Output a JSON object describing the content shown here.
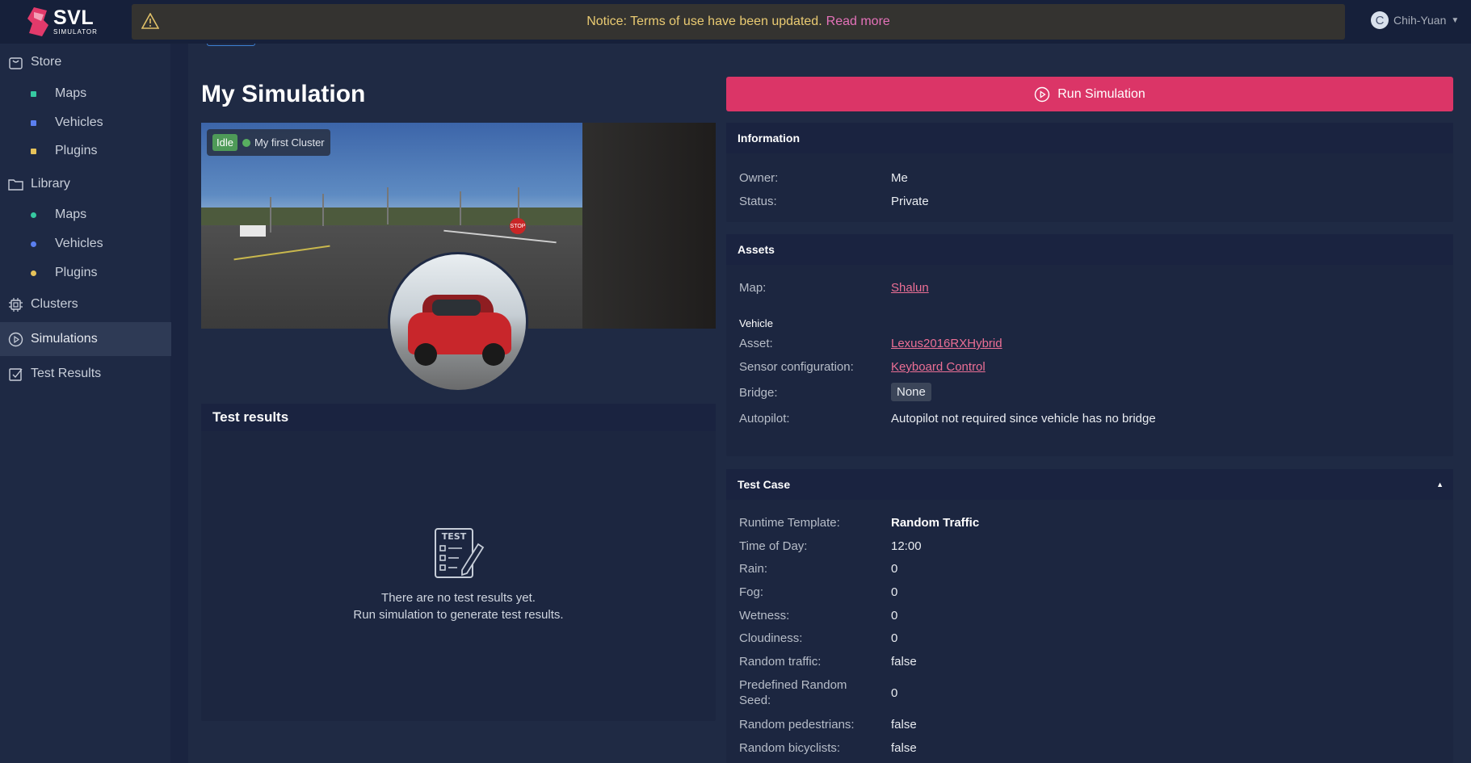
{
  "app": {
    "logo_text": "SVL",
    "logo_sub": "SIMULATOR"
  },
  "notice": {
    "text": "Notice: Terms of use have been updated.",
    "link": "Read more"
  },
  "user": {
    "initial": "C",
    "name": "Chih-Yuan"
  },
  "sidebar": {
    "store": "Store",
    "store_items": [
      {
        "label": "Maps",
        "color": "#36c9a1"
      },
      {
        "label": "Vehicles",
        "color": "#5b7ff0"
      },
      {
        "label": "Plugins",
        "color": "#e6c25a"
      }
    ],
    "library": "Library",
    "library_items": [
      {
        "label": "Maps",
        "color": "#36c9a1"
      },
      {
        "label": "Vehicles",
        "color": "#5b7ff0"
      },
      {
        "label": "Plugins",
        "color": "#e6c25a"
      }
    ],
    "clusters": "Clusters",
    "simulations": "Simulations",
    "test_results": "Test Results"
  },
  "page": {
    "title": "My Simulation"
  },
  "preview": {
    "status": "Idle",
    "cluster": "My first Cluster",
    "stop_sign": "STOP"
  },
  "test_results": {
    "title": "Test results",
    "icon_text": "TEST",
    "empty_line1": "There are no test results yet.",
    "empty_line2": "Run simulation to generate test results."
  },
  "run_button": "Run Simulation",
  "information": {
    "title": "Information",
    "owner_label": "Owner:",
    "owner": "Me",
    "status_label": "Status:",
    "status": "Private"
  },
  "assets": {
    "title": "Assets",
    "map_label": "Map:",
    "map": "Shalun",
    "vehicle_heading": "Vehicle",
    "asset_label": "Asset:",
    "asset": "Lexus2016RXHybrid",
    "sensor_label": "Sensor configuration:",
    "sensor": "Keyboard Control",
    "bridge_label": "Bridge:",
    "bridge": "None",
    "autopilot_label": "Autopilot:",
    "autopilot": "Autopilot not required since vehicle has no bridge"
  },
  "test_case": {
    "title": "Test Case",
    "rows": [
      {
        "label": "Runtime Template:",
        "value": "Random Traffic"
      },
      {
        "label": "Time of Day:",
        "value": "12:00"
      },
      {
        "label": "Rain:",
        "value": "0"
      },
      {
        "label": "Fog:",
        "value": "0"
      },
      {
        "label": "Wetness:",
        "value": "0"
      },
      {
        "label": "Cloudiness:",
        "value": "0"
      },
      {
        "label": "Random traffic:",
        "value": "false"
      },
      {
        "label_l1": "Predefined Random",
        "label_l2": "Seed:",
        "value": "0"
      },
      {
        "label": "Random pedestrians:",
        "value": "false"
      },
      {
        "label": "Random bicyclists:",
        "value": "false"
      }
    ]
  }
}
